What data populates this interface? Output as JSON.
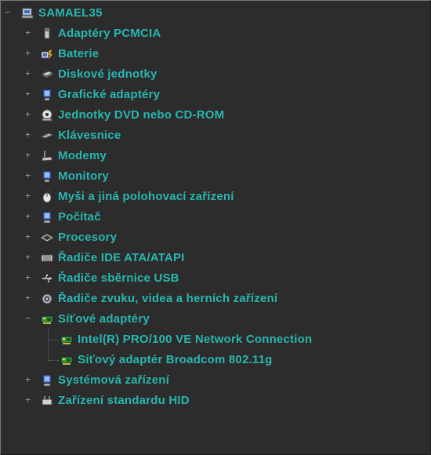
{
  "root": {
    "label": "SAMAEL35",
    "expanded": true,
    "icon": "computer-icon"
  },
  "categories": [
    {
      "label": "Adaptéry PCMCIA",
      "icon": "pcmcia-icon",
      "expanded": false
    },
    {
      "label": "Baterie",
      "icon": "battery-icon",
      "expanded": false
    },
    {
      "label": "Diskové jednotky",
      "icon": "disk-drive-icon",
      "expanded": false
    },
    {
      "label": "Grafické adaptéry",
      "icon": "display-adapter-icon",
      "expanded": false
    },
    {
      "label": "Jednotky DVD nebo CD-ROM",
      "icon": "cdrom-icon",
      "expanded": false
    },
    {
      "label": "Klávesnice",
      "icon": "keyboard-icon",
      "expanded": false
    },
    {
      "label": "Modemy",
      "icon": "modem-icon",
      "expanded": false
    },
    {
      "label": "Monitory",
      "icon": "monitor-icon",
      "expanded": false
    },
    {
      "label": "Myši a jiná polohovací zařízení",
      "icon": "mouse-icon",
      "expanded": false
    },
    {
      "label": "Počítač",
      "icon": "computer-icon",
      "expanded": false
    },
    {
      "label": "Procesory",
      "icon": "processor-icon",
      "expanded": false
    },
    {
      "label": "Řadiče IDE ATA/ATAPI",
      "icon": "ide-controller-icon",
      "expanded": false
    },
    {
      "label": "Řadiče sběrnice USB",
      "icon": "usb-icon",
      "expanded": false
    },
    {
      "label": "Řadiče zvuku, videa a herních zařízení",
      "icon": "sound-icon",
      "expanded": false
    },
    {
      "label": "Síťové adaptéry",
      "icon": "network-adapter-icon",
      "expanded": true,
      "children": [
        {
          "label": "Intel(R) PRO/100 VE Network Connection",
          "icon": "network-adapter-icon"
        },
        {
          "label": "Síťový adaptér Broadcom 802.11g",
          "icon": "network-adapter-icon"
        }
      ]
    },
    {
      "label": "Systémová zařízení",
      "icon": "system-device-icon",
      "expanded": false
    },
    {
      "label": "Zařízení standardu HID",
      "icon": "hid-icon",
      "expanded": false
    }
  ],
  "colors": {
    "background": "#2c2c2c",
    "text": "#29b6b0",
    "expander": "#9a9a9a"
  }
}
